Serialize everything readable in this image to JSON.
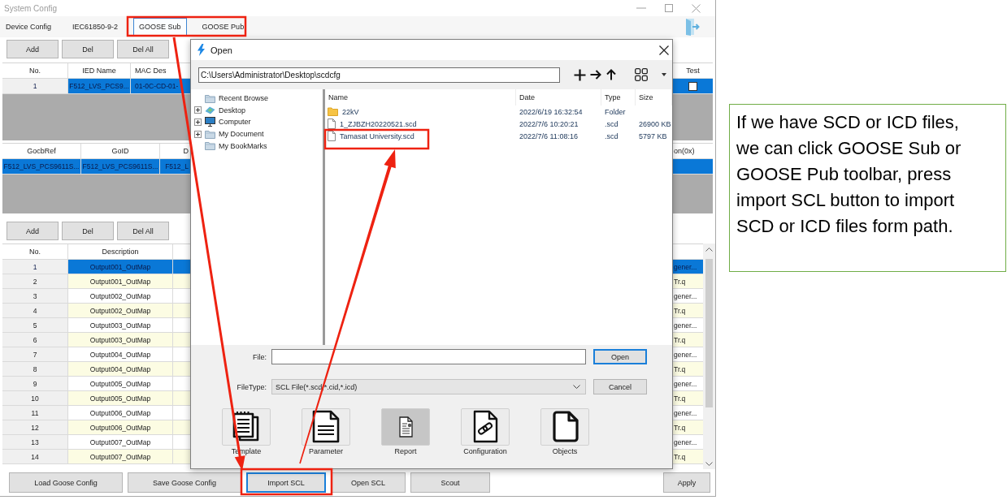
{
  "window": {
    "title": "System Config"
  },
  "toolbar": {
    "tabs": [
      {
        "label": "Device Config",
        "selected": false
      },
      {
        "label": "IEC61850-9-2",
        "selected": false
      },
      {
        "label": "GOOSE Sub",
        "selected": true
      },
      {
        "label": "GOOSE Pub",
        "selected": false
      }
    ]
  },
  "ied_section": {
    "buttons": [
      "Add",
      "Del",
      "Del All"
    ]
  },
  "ied_table": {
    "no_column": "No.",
    "columns": [
      "IED Name",
      "MAC Des"
    ],
    "edge_column": "Test",
    "rows": [
      {
        "no": "1",
        "cells": [
          "F512_LVS_PCS9...",
          "01-0C-CD-01-"
        ],
        "selected": true,
        "test_checked": false
      }
    ]
  },
  "gocb_table": {
    "columns": [
      "GocbRef",
      "GoID",
      "D"
    ],
    "edge_column": "on(0x)",
    "rows": [
      {
        "cells": [
          "F512_LVS_PCS9611S...",
          "F512_LVS_PCS9611S...",
          "F512_L"
        ],
        "selected": true
      }
    ]
  },
  "output_section": {
    "buttons": [
      "Add",
      "Del",
      "Del All"
    ]
  },
  "output_table": {
    "no_column": "No.",
    "columns": [
      "Description"
    ],
    "rows": [
      {
        "no": "1",
        "cells": [
          "Output001_OutMap"
        ],
        "edge": "gener...",
        "selected": true
      },
      {
        "no": "2",
        "cells": [
          "Output001_OutMap"
        ],
        "edge": "Tr.q",
        "selected": false
      },
      {
        "no": "3",
        "cells": [
          "Output002_OutMap"
        ],
        "edge": "gener...",
        "selected": false
      },
      {
        "no": "4",
        "cells": [
          "Output002_OutMap"
        ],
        "edge": "Tr.q",
        "selected": false
      },
      {
        "no": "5",
        "cells": [
          "Output003_OutMap"
        ],
        "edge": "gener...",
        "selected": false
      },
      {
        "no": "6",
        "cells": [
          "Output003_OutMap"
        ],
        "edge": "Tr.q",
        "selected": false
      },
      {
        "no": "7",
        "cells": [
          "Output004_OutMap"
        ],
        "edge": "gener...",
        "selected": false
      },
      {
        "no": "8",
        "cells": [
          "Output004_OutMap"
        ],
        "edge": "Tr.q",
        "selected": false
      },
      {
        "no": "9",
        "cells": [
          "Output005_OutMap"
        ],
        "edge": "gener...",
        "selected": false
      },
      {
        "no": "10",
        "cells": [
          "Output005_OutMap"
        ],
        "edge": "Tr.q",
        "selected": false
      },
      {
        "no": "11",
        "cells": [
          "Output006_OutMap"
        ],
        "edge": "gener...",
        "selected": false
      },
      {
        "no": "12",
        "cells": [
          "Output006_OutMap"
        ],
        "edge": "Tr.q",
        "selected": false
      },
      {
        "no": "13",
        "cells": [
          "Output007_OutMap"
        ],
        "edge": "gener...",
        "selected": false
      },
      {
        "no": "14",
        "cells": [
          "Output007_OutMap"
        ],
        "edge": "Tr.q",
        "selected": false
      }
    ]
  },
  "bottom_bar": {
    "buttons": [
      {
        "label": "Load Goose Config",
        "focused": false
      },
      {
        "label": "Save Goose Config",
        "focused": false
      },
      {
        "label": "Import SCL",
        "focused": true
      },
      {
        "label": "Open SCL",
        "focused": false
      },
      {
        "label": "Scout",
        "focused": false
      }
    ],
    "apply": "Apply"
  },
  "dialog": {
    "title": "Open",
    "path": "C:\\Users\\Administrator\\Desktop\\scdcfg",
    "tree": [
      {
        "label": "Recent Browse",
        "kind": "folder",
        "expandable": false
      },
      {
        "label": "Desktop",
        "kind": "desktop",
        "expandable": true
      },
      {
        "label": "Computer",
        "kind": "computer",
        "expandable": true
      },
      {
        "label": "My Document",
        "kind": "folder",
        "expandable": true
      },
      {
        "label": "My BookMarks",
        "kind": "folder",
        "expandable": false
      }
    ],
    "file_list": {
      "columns": [
        "Name",
        "Date",
        "Type",
        "Size"
      ],
      "rows": [
        {
          "kind": "folder",
          "name": "22kV",
          "date": "2022/6/19 16:32:54",
          "type": "Folder"
        },
        {
          "kind": "file",
          "name": "1_ZJBZH20220521.scd",
          "date": "2022/7/6 10:20:21",
          "type": ".scd",
          "size": "26900 KB"
        },
        {
          "kind": "file",
          "name": "Tamasat University.scd",
          "date": "2022/7/6 11:08:16",
          "type": ".scd",
          "size": "5797 KB"
        }
      ]
    },
    "file_field": {
      "label": "File:"
    },
    "filetype_field": {
      "label": "FileType:",
      "value": "SCL File(*.scd,*.cid,*.icd)"
    },
    "buttons": [
      {
        "label": "Open",
        "default": true
      },
      {
        "label": "Cancel",
        "default": false
      }
    ],
    "shortcuts": [
      {
        "label": "Template",
        "kind": "template",
        "selected": false
      },
      {
        "label": "Parameter",
        "kind": "parameter",
        "selected": false
      },
      {
        "label": "Report",
        "kind": "report",
        "selected": true
      },
      {
        "label": "Configuration",
        "kind": "configuration",
        "selected": false
      },
      {
        "label": "Objects",
        "kind": "objects",
        "selected": false
      }
    ]
  },
  "note": {
    "text": "If we have SCD or ICD files, we can click GOOSE Sub or GOOSE Pub toolbar, press import SCL button to import SCD or ICD files form path."
  }
}
